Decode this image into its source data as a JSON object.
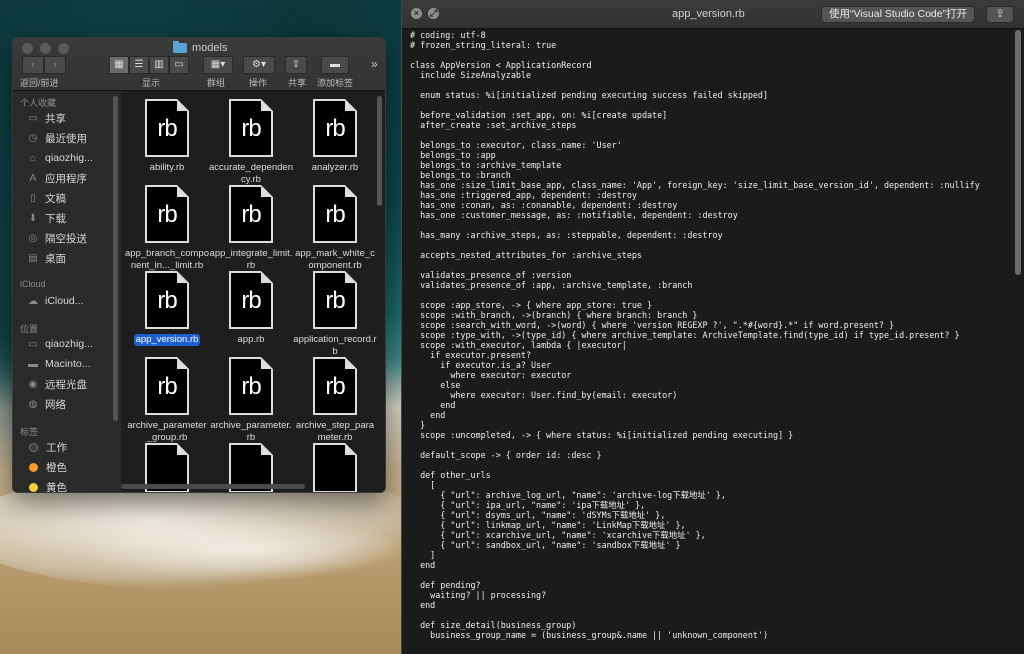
{
  "finder": {
    "title": "models",
    "nav_label": "返回/前进",
    "toolbar": {
      "display_label": "显示",
      "group_label": "群组",
      "action_label": "操作",
      "share_label": "共享",
      "tag_label": "添加标签"
    },
    "sidebar": {
      "favorites_header": "个人收藏",
      "favorites": [
        "共享",
        "最近使用",
        "qiaozhig...",
        "应用程序",
        "文稿",
        "下载",
        "隔空投送",
        "桌面"
      ],
      "icloud_header": "iCloud",
      "icloud": [
        "iCloud..."
      ],
      "locations_header": "位置",
      "locations": [
        "qiaozhig...",
        "Macinto...",
        "远程光盘",
        "网络"
      ],
      "tags_header": "标签",
      "tags": [
        {
          "label": "工作",
          "color": "#3c3c3c"
        },
        {
          "label": "橙色",
          "color": "#f39a2b"
        },
        {
          "label": "黄色",
          "color": "#f6d33c"
        }
      ]
    },
    "file_icon_text": "rb",
    "files": [
      "ability.rb",
      "accurate_dependency.rb",
      "analyzer.rb",
      "app_branch_component_in..._limit.rb",
      "app_integrate_limit.rb",
      "app_mark_white_component.rb",
      "app_version.rb",
      "app.rb",
      "application_record.rb",
      "archive_parameter_group.rb",
      "archive_parameter.rb",
      "archive_step_parameter.rb",
      "",
      "",
      ""
    ],
    "selected_file": "app_version.rb"
  },
  "editor": {
    "title": "app_version.rb",
    "open_with": "使用“Visual Studio Code”打开",
    "code": "# coding: utf-8\n# frozen_string_literal: true\n\nclass AppVersion < ApplicationRecord\n  include SizeAnalyzable\n\n  enum status: %i[initialized pending executing success failed skipped]\n\n  before_validation :set_app, on: %i[create update]\n  after_create :set_archive_steps\n\n  belongs_to :executor, class_name: 'User'\n  belongs_to :app\n  belongs_to :archive_template\n  belongs_to :branch\n  has_one :size_limit_base_app, class_name: 'App', foreign_key: 'size_limit_base_version_id', dependent: :nullify\n  has_one :triggered_app, dependent: :destroy\n  has_one :conan, as: :conanable, dependent: :destroy\n  has_one :customer_message, as: :notifiable, dependent: :destroy\n\n  has_many :archive_steps, as: :steppable, dependent: :destroy\n\n  accepts_nested_attributes_for :archive_steps\n\n  validates_presence_of :version\n  validates_presence_of :app, :archive_template, :branch\n\n  scope :app_store, -> { where app_store: true }\n  scope :with_branch, ->(branch) { where branch: branch }\n  scope :search_with_word, ->(word) { where 'version REGEXP ?', \".*#{word}.*\" if word.present? }\n  scope :type_with, ->(type_id) { where archive_template: ArchiveTemplate.find(type_id) if type_id.present? }\n  scope :with_executor, lambda { |executor|\n    if executor.present?\n      if executor.is_a? User\n        where executor: executor\n      else\n        where executor: User.find_by(email: executor)\n      end\n    end\n  }\n  scope :uncompleted, -> { where status: %i[initialized pending executing] }\n\n  default_scope -> { order id: :desc }\n\n  def other_urls\n    [\n      { \"url\": archive_log_url, \"name\": 'archive-log下载地址' },\n      { \"url\": ipa_url, \"name\": 'ipa下载地址' },\n      { \"url\": dsyms_url, \"name\": 'dSYMs下载地址' },\n      { \"url\": linkmap_url, \"name\": 'LinkMap下载地址' },\n      { \"url\": xcarchive_url, \"name\": 'xcarchive下载地址' },\n      { \"url\": sandbox_url, \"name\": 'sandbox下载地址' }\n    ]\n  end\n\n  def pending?\n    waiting? || processing?\n  end\n\n  def size_detail(business_group)\n    business_group_name = (business_group&.name || 'unknown_component')"
  }
}
